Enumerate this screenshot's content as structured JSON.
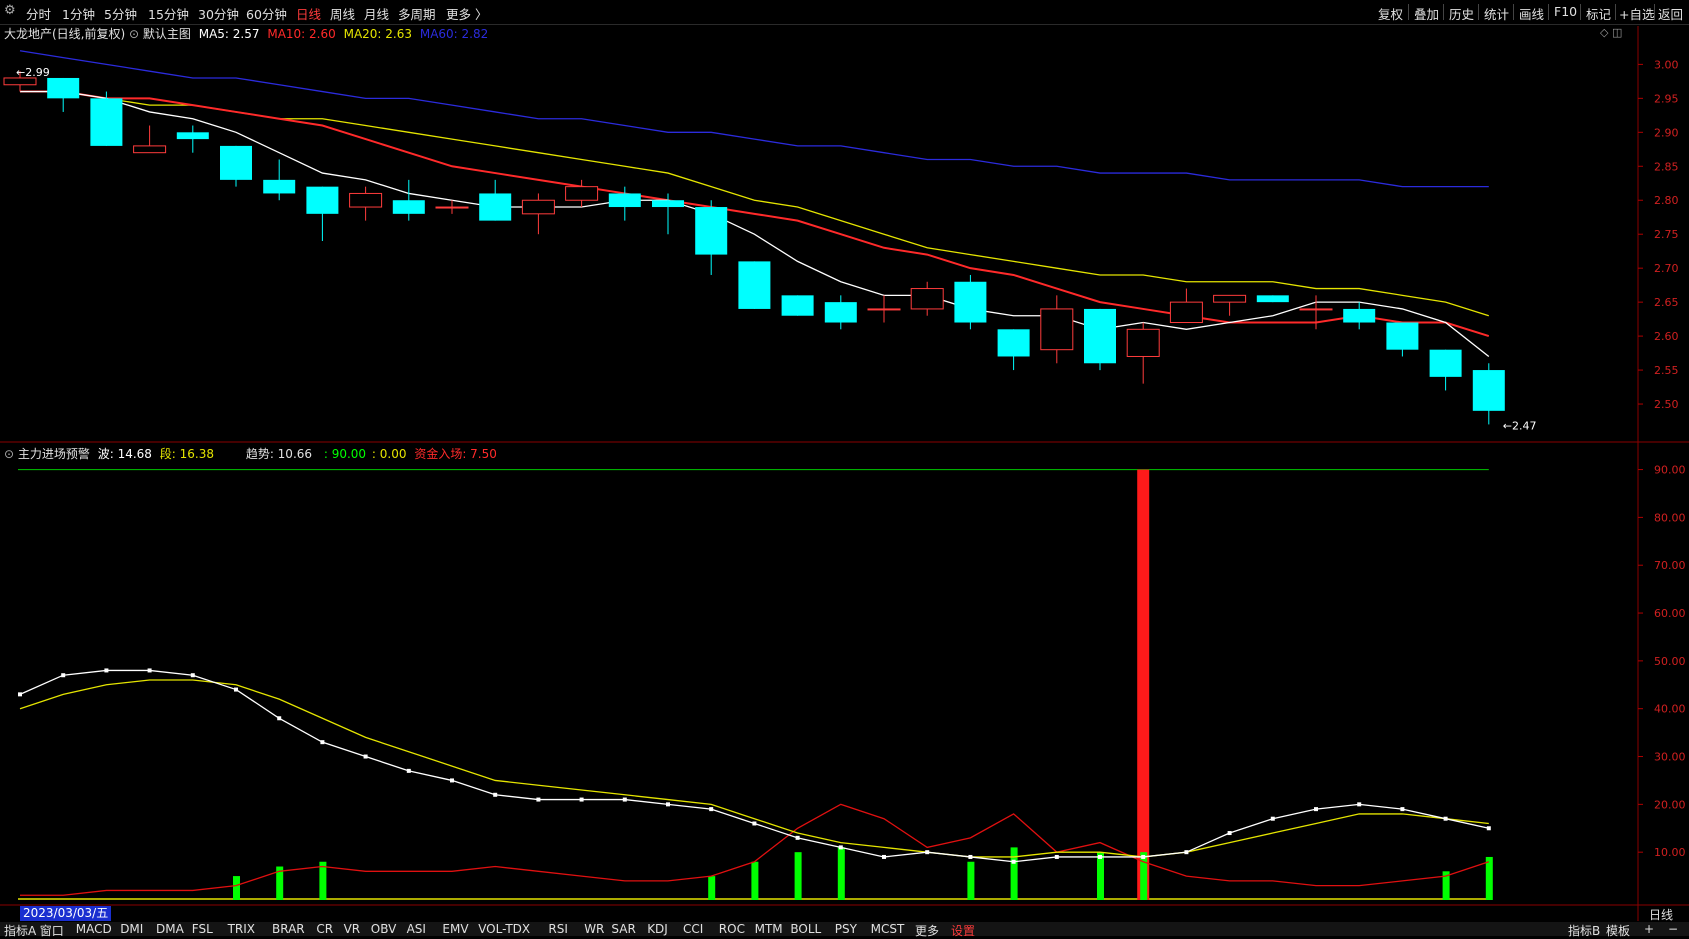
{
  "toolbar": {
    "periods": [
      "分时",
      "1分钟",
      "5分钟",
      "15分钟",
      "30分钟",
      "60分钟",
      "日线",
      "周线",
      "月线",
      "多周期",
      "更多 〉"
    ],
    "active_period": "日线",
    "right_items": [
      "复权",
      "叠加",
      "历史",
      "统计",
      "画线",
      "F10",
      "标记",
      "+自选",
      "返回"
    ]
  },
  "main_panel": {
    "stock_name": "大龙地产(日线,前复权)",
    "template": "默认主图",
    "ma5": "MA5: 2.57",
    "ma10": "MA10: 2.60",
    "ma20": "MA20: 2.63",
    "ma60": "MA60: 2.82",
    "high_label": "2.99",
    "low_label": "2.47",
    "y_ticks": [
      "3.00",
      "2.95",
      "2.90",
      "2.85",
      "2.80",
      "2.75",
      "2.70",
      "2.65",
      "2.60",
      "2.55",
      "2.50"
    ],
    "colors": {
      "ma5": "#ffffff",
      "ma10": "#ff2a2a",
      "ma20": "#e4e400",
      "ma60": "#2b2bdc",
      "down": "#00ffff",
      "up": "#ff3c3c"
    }
  },
  "indicator_panel": {
    "title": "主力进场预警",
    "bo": "波: 14.68",
    "duan": "段: 16.38",
    "trend": "趋势: 10.66",
    "v1": ": 90.00",
    "v2": ": 0.00",
    "capital": "资金入场: 7.50",
    "y_ticks": [
      "90.00",
      "80.00",
      "70.00",
      "60.00",
      "50.00",
      "40.00",
      "30.00",
      "20.00",
      "10.00"
    ]
  },
  "bottom": {
    "date": "2023/03/03/五",
    "period": "日线",
    "tabs": [
      "指标A",
      "窗口",
      "MACD",
      "DMI",
      "DMA",
      "FSL",
      "TRIX",
      "BRAR",
      "CR",
      "VR",
      "OBV",
      "ASI",
      "EMV",
      "VOL-TDX",
      "RSI",
      "WR",
      "SAR",
      "KDJ",
      "CCI",
      "ROC",
      "MTM",
      "BOLL",
      "PSY",
      "MCST",
      "更多",
      "设置"
    ],
    "right_tabs": [
      "指标B",
      "模板",
      "+",
      "−"
    ]
  },
  "chart_data": [
    {
      "type": "candlestick",
      "title": "大龙地产(日线,前复权)",
      "ylim": [
        2.45,
        3.03
      ],
      "candles": [
        {
          "o": 2.97,
          "h": 2.99,
          "l": 2.96,
          "c": 2.98
        },
        {
          "o": 2.98,
          "h": 2.98,
          "l": 2.93,
          "c": 2.95
        },
        {
          "o": 2.95,
          "h": 2.96,
          "l": 2.88,
          "c": 2.88
        },
        {
          "o": 2.87,
          "h": 2.91,
          "l": 2.87,
          "c": 2.88
        },
        {
          "o": 2.9,
          "h": 2.91,
          "l": 2.87,
          "c": 2.89
        },
        {
          "o": 2.88,
          "h": 2.88,
          "l": 2.82,
          "c": 2.83
        },
        {
          "o": 2.83,
          "h": 2.86,
          "l": 2.8,
          "c": 2.81
        },
        {
          "o": 2.82,
          "h": 2.82,
          "l": 2.74,
          "c": 2.78
        },
        {
          "o": 2.79,
          "h": 2.82,
          "l": 2.77,
          "c": 2.81
        },
        {
          "o": 2.8,
          "h": 2.83,
          "l": 2.77,
          "c": 2.78
        },
        {
          "o": 2.79,
          "h": 2.8,
          "l": 2.78,
          "c": 2.79
        },
        {
          "o": 2.81,
          "h": 2.83,
          "l": 2.77,
          "c": 2.77
        },
        {
          "o": 2.78,
          "h": 2.81,
          "l": 2.75,
          "c": 2.8
        },
        {
          "o": 2.8,
          "h": 2.83,
          "l": 2.79,
          "c": 2.82
        },
        {
          "o": 2.81,
          "h": 2.82,
          "l": 2.77,
          "c": 2.79
        },
        {
          "o": 2.8,
          "h": 2.81,
          "l": 2.75,
          "c": 2.79
        },
        {
          "o": 2.79,
          "h": 2.8,
          "l": 2.69,
          "c": 2.72
        },
        {
          "o": 2.71,
          "h": 2.71,
          "l": 2.64,
          "c": 2.64
        },
        {
          "o": 2.66,
          "h": 2.66,
          "l": 2.63,
          "c": 2.63
        },
        {
          "o": 2.65,
          "h": 2.66,
          "l": 2.61,
          "c": 2.62
        },
        {
          "o": 2.64,
          "h": 2.66,
          "l": 2.62,
          "c": 2.64
        },
        {
          "o": 2.64,
          "h": 2.68,
          "l": 2.63,
          "c": 2.67
        },
        {
          "o": 2.68,
          "h": 2.69,
          "l": 2.61,
          "c": 2.62
        },
        {
          "o": 2.61,
          "h": 2.61,
          "l": 2.55,
          "c": 2.57
        },
        {
          "o": 2.58,
          "h": 2.66,
          "l": 2.56,
          "c": 2.64
        },
        {
          "o": 2.64,
          "h": 2.64,
          "l": 2.55,
          "c": 2.56
        },
        {
          "o": 2.57,
          "h": 2.62,
          "l": 2.53,
          "c": 2.61
        },
        {
          "o": 2.62,
          "h": 2.67,
          "l": 2.62,
          "c": 2.65
        },
        {
          "o": 2.65,
          "h": 2.66,
          "l": 2.63,
          "c": 2.66
        },
        {
          "o": 2.66,
          "h": 2.66,
          "l": 2.65,
          "c": 2.65
        },
        {
          "o": 2.64,
          "h": 2.66,
          "l": 2.61,
          "c": 2.64
        },
        {
          "o": 2.64,
          "h": 2.65,
          "l": 2.61,
          "c": 2.62
        },
        {
          "o": 2.62,
          "h": 2.62,
          "l": 2.57,
          "c": 2.58
        },
        {
          "o": 2.58,
          "h": 2.58,
          "l": 2.52,
          "c": 2.54
        },
        {
          "o": 2.55,
          "h": 2.56,
          "l": 2.47,
          "c": 2.49
        }
      ],
      "ma5": [
        2.96,
        2.96,
        2.95,
        2.93,
        2.92,
        2.9,
        2.87,
        2.84,
        2.83,
        2.81,
        2.8,
        2.79,
        2.79,
        2.79,
        2.8,
        2.8,
        2.78,
        2.75,
        2.71,
        2.68,
        2.66,
        2.66,
        2.64,
        2.63,
        2.63,
        2.61,
        2.62,
        2.61,
        2.62,
        2.63,
        2.65,
        2.65,
        2.64,
        2.62,
        2.57
      ],
      "ma10": [
        2.96,
        2.96,
        2.95,
        2.95,
        2.94,
        2.93,
        2.92,
        2.91,
        2.89,
        2.87,
        2.85,
        2.84,
        2.83,
        2.82,
        2.81,
        2.8,
        2.79,
        2.78,
        2.77,
        2.75,
        2.73,
        2.72,
        2.7,
        2.69,
        2.67,
        2.65,
        2.64,
        2.63,
        2.62,
        2.62,
        2.62,
        2.63,
        2.62,
        2.62,
        2.6
      ],
      "ma20": [
        2.96,
        2.96,
        2.95,
        2.94,
        2.94,
        2.93,
        2.92,
        2.92,
        2.91,
        2.9,
        2.89,
        2.88,
        2.87,
        2.86,
        2.85,
        2.84,
        2.82,
        2.8,
        2.79,
        2.77,
        2.75,
        2.73,
        2.72,
        2.71,
        2.7,
        2.69,
        2.69,
        2.68,
        2.68,
        2.68,
        2.67,
        2.67,
        2.66,
        2.65,
        2.63
      ],
      "ma60": [
        3.02,
        3.01,
        3.0,
        2.99,
        2.98,
        2.98,
        2.97,
        2.96,
        2.95,
        2.95,
        2.94,
        2.93,
        2.92,
        2.92,
        2.91,
        2.9,
        2.9,
        2.89,
        2.88,
        2.88,
        2.87,
        2.86,
        2.86,
        2.85,
        2.85,
        2.84,
        2.84,
        2.84,
        2.83,
        2.83,
        2.83,
        2.83,
        2.82,
        2.82,
        2.82
      ]
    },
    {
      "type": "bar-line",
      "title": "主力进场预警",
      "ylim": [
        0,
        92
      ],
      "bo_line": [
        43,
        47,
        48,
        48,
        47,
        44,
        38,
        33,
        30,
        27,
        25,
        22,
        21,
        21,
        21,
        20,
        19,
        16,
        13,
        11,
        9,
        10,
        9,
        8,
        9,
        9,
        9,
        10,
        14,
        17,
        19,
        20,
        19,
        17,
        15
      ],
      "duan_line": [
        40,
        43,
        45,
        46,
        46,
        45,
        42,
        38,
        34,
        31,
        28,
        25,
        24,
        23,
        22,
        21,
        20,
        17,
        14,
        12,
        11,
        10,
        9,
        9,
        10,
        10,
        9,
        10,
        12,
        14,
        16,
        18,
        18,
        17,
        16
      ],
      "red_line": [
        1,
        1,
        2,
        2,
        2,
        3,
        6,
        7,
        6,
        6,
        6,
        7,
        6,
        5,
        4,
        4,
        5,
        8,
        15,
        20,
        17,
        11,
        13,
        18,
        10,
        12,
        8,
        5,
        4,
        4,
        3,
        3,
        4,
        5,
        8
      ],
      "green_bars": [
        0,
        0,
        0,
        0,
        0,
        5,
        7,
        8,
        0,
        0,
        0,
        0,
        0,
        0,
        0,
        0,
        5,
        8,
        10,
        11,
        0,
        0,
        8,
        11,
        0,
        10,
        10,
        0,
        0,
        0,
        0,
        0,
        0,
        6,
        9
      ],
      "alert_index": 26,
      "alert_value": 90
    }
  ]
}
